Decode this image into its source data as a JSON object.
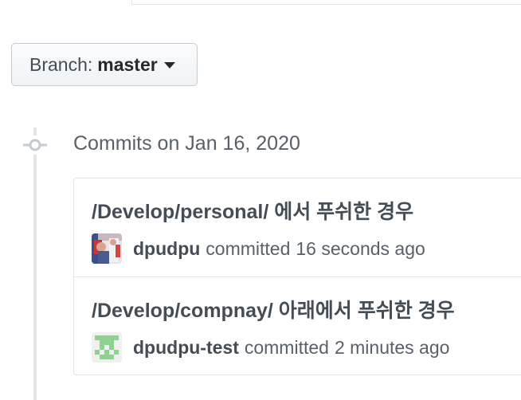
{
  "branch": {
    "label": "Branch:",
    "name": "master"
  },
  "commit_group": {
    "title": "Commits on Jan 16, 2020",
    "commits": [
      {
        "message": "/Develop/personal/ 에서 푸쉬한 경우",
        "author": "dpudpu",
        "verb": "committed",
        "time": "16 seconds ago",
        "avatar": "photo-avatar"
      },
      {
        "message": "/Develop/compnay/ 아래에서 푸쉬한 경우",
        "author": "dpudpu-test",
        "verb": "committed",
        "time": "2 minutes ago",
        "avatar": "identicon-avatar"
      }
    ]
  },
  "colors": {
    "text_primary": "#24292e",
    "text_secondary": "#586069",
    "border": "#e1e4e8",
    "identicon_green": "#8fd18e"
  }
}
